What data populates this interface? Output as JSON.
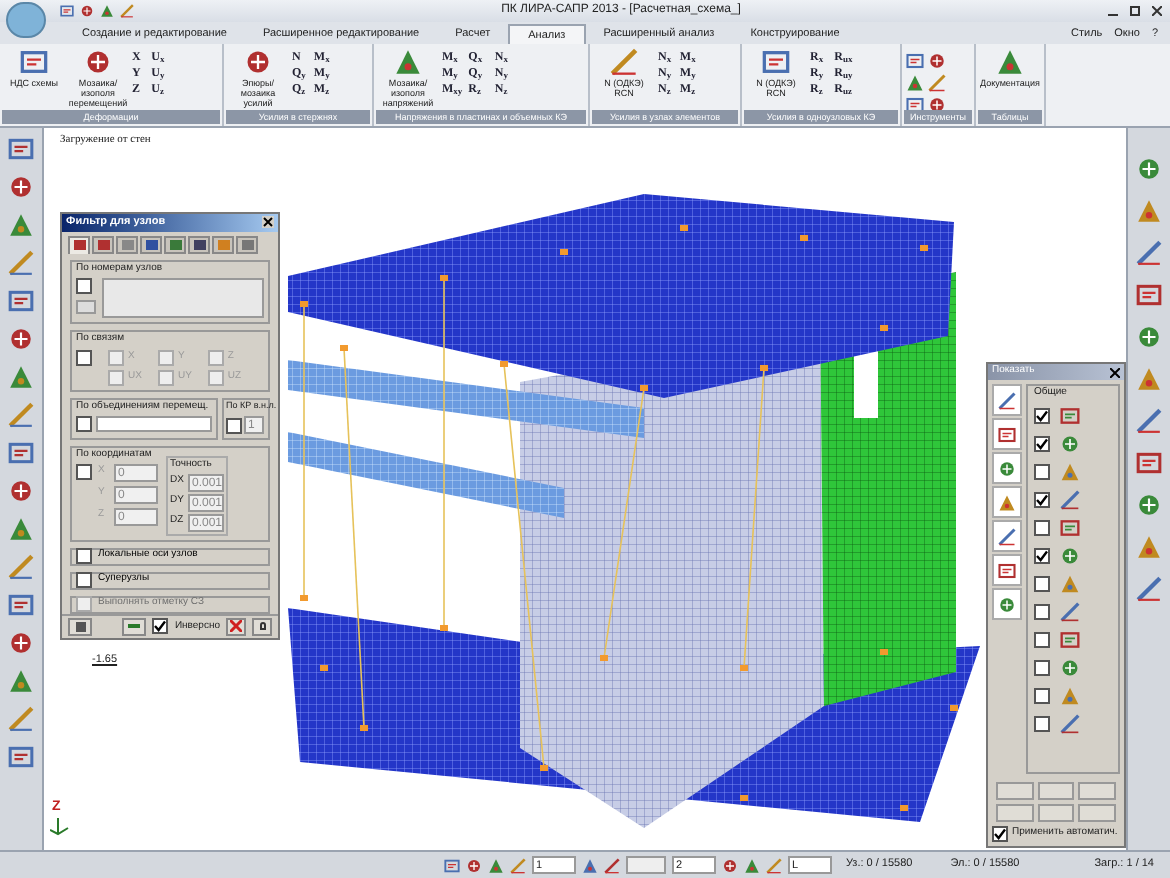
{
  "window": {
    "title": "ПК ЛИРА-САПР 2013 - [Расчетная_схема_]"
  },
  "menu_right": [
    "Стиль",
    "Окно",
    "?"
  ],
  "tabs": [
    {
      "label": "Создание и редактирование",
      "selected": false
    },
    {
      "label": "Расширенное редактирование",
      "selected": false
    },
    {
      "label": "Расчет",
      "selected": false
    },
    {
      "label": "Анализ",
      "selected": true
    },
    {
      "label": "Расширенный анализ",
      "selected": false
    },
    {
      "label": "Конструирование",
      "selected": false
    }
  ],
  "ribbon": [
    {
      "label": "Деформации",
      "large": [
        "НДС схемы",
        "Мозаика/изополя перемещений"
      ],
      "small": [
        "X",
        "U$_{x}$",
        "Y",
        "U$_{y}$",
        "Z",
        "U$_{z}$"
      ]
    },
    {
      "label": "Усилия в стержнях",
      "large": [
        "Эпюры/мозаика усилий"
      ],
      "small": [
        "N",
        "M$_{x}$",
        "Q$_{y}$",
        "M$_{y}$",
        "Q$_{z}$",
        "M$_{z}$"
      ]
    },
    {
      "label": "Напряжения в пластинах и объемных КЭ",
      "large": [
        "Мозаика/изополя напряжений"
      ],
      "small": [
        "M$_{x}$",
        "Q$_{x}$",
        "N$_{x}$",
        "M$_{y}$",
        "Q$_{y}$",
        "N$_{y}$",
        "M$_{xy}$",
        "R$_{z}$",
        "N$_{z}$"
      ]
    },
    {
      "label": "Усилия в узлах элементов",
      "large": [
        "N (ОДКЭ) RCN"
      ],
      "small": [
        "N$_{x}$",
        "M$_{x}$",
        "N$_{y}$",
        "M$_{y}$",
        "N$_{z}$",
        "M$_{z}$"
      ]
    },
    {
      "label": "Усилия в одноузловых КЭ",
      "large": [
        "N (ОДКЭ) RCN"
      ],
      "small": [
        "R$_{x}$",
        "R$_{ux}$",
        "R$_{y}$",
        "R$_{uy}$",
        "R$_{z}$",
        "R$_{uz}$"
      ]
    },
    {
      "label": "Инструменты",
      "tools": true
    },
    {
      "label": "Таблицы",
      "large": [
        "Документация"
      ]
    }
  ],
  "canvas": {
    "caption": "Загружение от стен",
    "mark": "-1.65",
    "axis": "Z"
  },
  "filter_dialog": {
    "title": "Фильтр для узлов",
    "tabs": [
      {
        "selected": true
      },
      {
        "selected": false
      },
      {
        "selected": false
      },
      {
        "selected": false
      },
      {
        "selected": false
      },
      {
        "selected": false
      },
      {
        "selected": false
      },
      {
        "selected": false
      }
    ],
    "by_numbers": {
      "label": "По номерам узлов",
      "checked": false
    },
    "by_links": {
      "label": "По связям",
      "checked": false,
      "options": [
        {
          "label": "X",
          "checked": false
        },
        {
          "label": "Y",
          "checked": false
        },
        {
          "label": "Z",
          "checked": false
        },
        {
          "label": "UX",
          "checked": false
        },
        {
          "label": "UY",
          "checked": false
        },
        {
          "label": "UZ",
          "checked": false
        }
      ]
    },
    "by_union": {
      "label": "По объединениям перемещ.",
      "checked": false
    },
    "by_kr": {
      "label": "По КР в.н.л.",
      "checked": false,
      "value": "1"
    },
    "by_coords": {
      "label": "По координатам",
      "checked": false,
      "fields": [
        {
          "label": "X",
          "value": "0"
        },
        {
          "label": "Y",
          "value": "0"
        },
        {
          "label": "Z",
          "value": "0"
        }
      ]
    },
    "precision": {
      "label": "Точность",
      "fields": [
        {
          "label": "DX",
          "value": "0.001"
        },
        {
          "label": "DY",
          "value": "0.001"
        },
        {
          "label": "DZ",
          "value": "0.001"
        }
      ]
    },
    "options": [
      {
        "label": "Локальные оси узлов",
        "checked": false,
        "disabled": false
      },
      {
        "label": "Суперузлы",
        "checked": false,
        "disabled": false
      },
      {
        "label": "Выполнять отметку СЗ",
        "checked": false,
        "disabled": true
      }
    ],
    "inverse": {
      "label": "Инверсно",
      "checked": true
    }
  },
  "show_panel": {
    "title": "Показать",
    "group": "Общие",
    "items": [
      {
        "checked": true
      },
      {
        "checked": true
      },
      {
        "checked": false
      },
      {
        "checked": true
      },
      {
        "checked": false
      },
      {
        "checked": true
      },
      {
        "checked": false
      },
      {
        "checked": false
      },
      {
        "checked": false
      },
      {
        "checked": false
      },
      {
        "checked": false
      },
      {
        "checked": false
      }
    ],
    "auto": {
      "label": "Применить автоматич.",
      "checked": true
    }
  },
  "status_bar": {
    "field_1": "1",
    "field_2": "2",
    "field_3": "L",
    "nodes": "Уз.: 0 / 15580",
    "elements": "Эл.: 0 / 15580",
    "loads": "Загр.: 1 / 14"
  }
}
